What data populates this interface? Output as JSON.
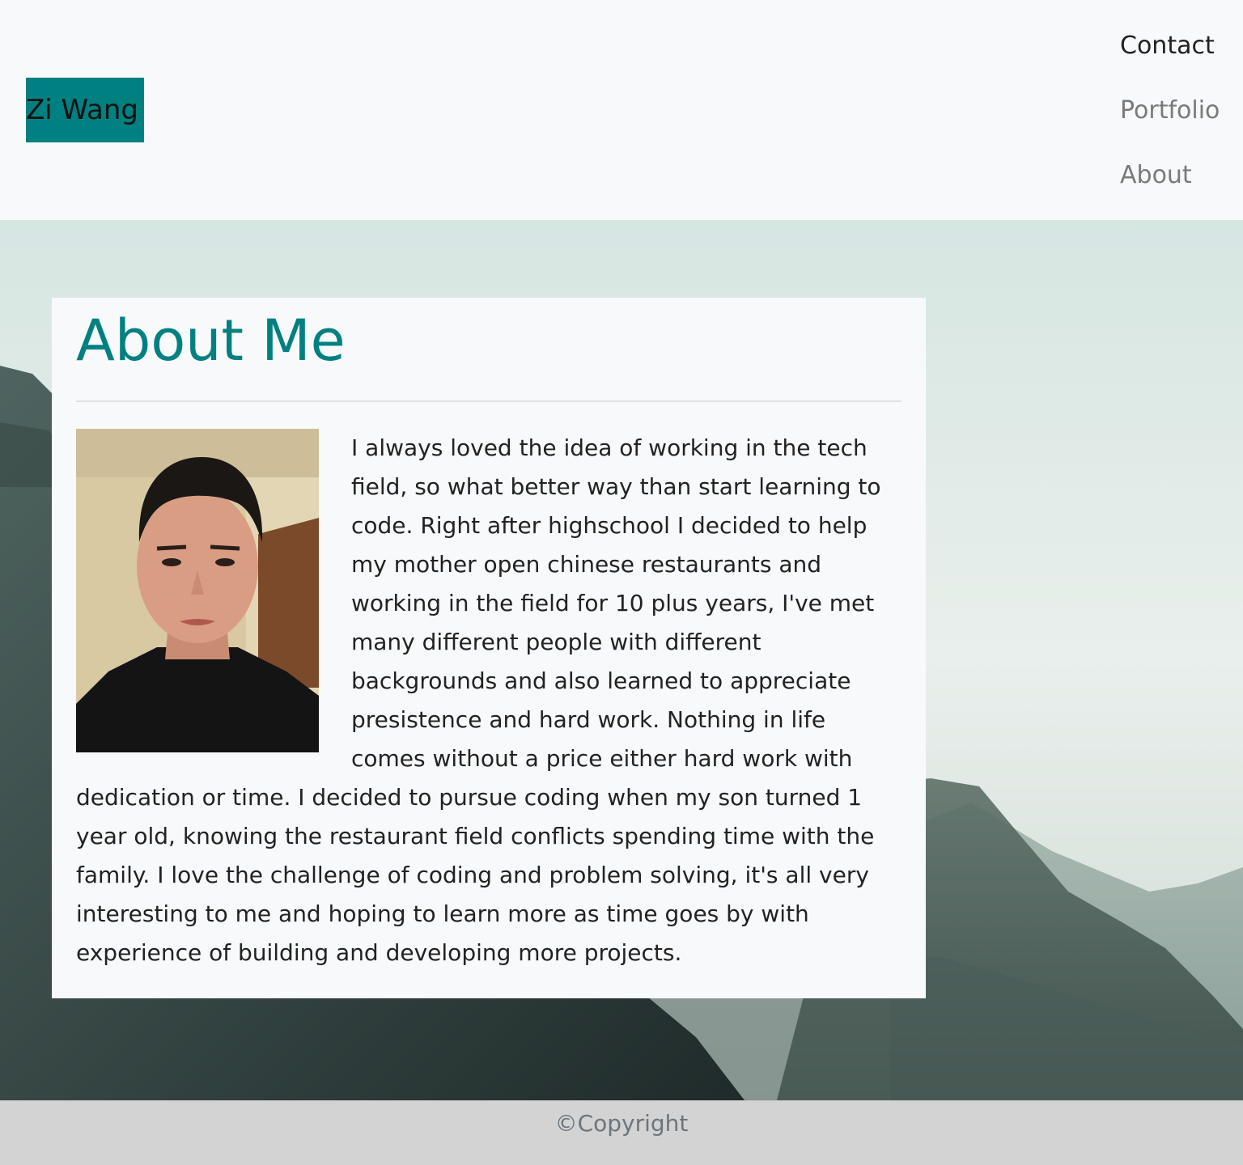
{
  "navbar": {
    "brand": "Zi Wang",
    "links": [
      {
        "label": "Contact"
      },
      {
        "label": "Portfolio"
      },
      {
        "label": "About"
      }
    ]
  },
  "about": {
    "title": "About Me",
    "body": "I always loved the idea of working in the tech field, so what better way than start learning to code. Right after highschool I decided to help my mother open chinese restaurants and working in the field for 10 plus years, I've met many different people with different backgrounds and also learned to appreciate presistence and hard work. Nothing in life comes without a price either hard work with dedication or time. I decided to pursue coding when my son turned 1 year old, knowing the restaurant field conflicts spending time with the family. I love the challenge of coding and problem solving, it's all very interesting to me and hoping to learn more as time goes by with experience of building and developing more projects."
  },
  "footer": {
    "text": "©Copyright"
  },
  "colors": {
    "brand_bg": "#008080",
    "title": "#008080",
    "navbar_bg": "#f8f9fa",
    "footer_bg": "#d3d3d3"
  }
}
